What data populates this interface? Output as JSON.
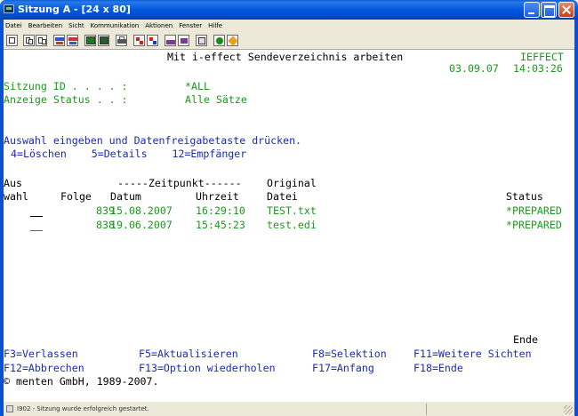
{
  "window": {
    "title": "Sitzung A - [24 x 80]"
  },
  "menu": {
    "items": [
      "Datei",
      "Bearbeiten",
      "Sicht",
      "Kommunikation",
      "Aktionen",
      "Fenster",
      "Hilfe"
    ]
  },
  "toolbar": {
    "icons": [
      "copy-icon",
      "paste-icon",
      "cut-icon",
      "send-icon",
      "receive-icon",
      "screen-icon",
      "macro-icon",
      "print-icon",
      "record-icon",
      "play-icon",
      "keyboard-icon",
      "help-icon",
      "color-icon",
      "settings-icon"
    ]
  },
  "screen": {
    "header_title": "Mit i-effect Sendeverzeichnis arbeiten",
    "system_name": "IEFFECT",
    "date": "03.09.07",
    "time": "14:03:26",
    "session_label": "Sitzung ID . . . . :",
    "session_value": "*ALL",
    "status_label": "Anzeige Status . . :",
    "status_value": "Alle Sätze",
    "instruction": "Auswahl eingeben und Datenfreigabetaste drücken.",
    "options": "4=Löschen    5=Details    12=Empfänger",
    "col_header_line1": {
      "aus": "Aus",
      "zeitpunkt": "-----Zeitpunkt------",
      "original": "Original"
    },
    "col_header_line2": {
      "wahl": "wahl",
      "folge": "Folge",
      "datum": "Datum",
      "uhrzeit": "Uhrzeit",
      "datei": "Datei",
      "status": "Status"
    },
    "rows": [
      {
        "folge": "839",
        "datum": "15.08.2007",
        "uhrzeit": "16:29:10",
        "datei": "TEST.txt",
        "status": "*PREPARED"
      },
      {
        "folge": "838",
        "datum": "19.06.2007",
        "uhrzeit": "15:45:23",
        "datei": "test.edi",
        "status": "*PREPARED"
      }
    ],
    "ende": "Ende",
    "fkeys_line1": {
      "f3": "F3=Verlassen",
      "f5": "F5=Aktualisieren",
      "f8": "F8=Selektion",
      "f11": "F11=Weitere Sichten"
    },
    "fkeys_line2": {
      "f12": "F12=Abbrechen",
      "f13": "F13=Option wiederholen",
      "f17": "F17=Anfang",
      "f18": "F18=Ende"
    },
    "copyright": "© menten GmbH, 1989-2007."
  },
  "statusbar": {
    "message": "I902 - Sitzung wurde erfolgreich gestartet."
  },
  "colors": {
    "title_bar": "#0058e0",
    "text_green": "#1a9a1a",
    "text_blue": "#1a2ab8",
    "text_black": "#000000"
  }
}
